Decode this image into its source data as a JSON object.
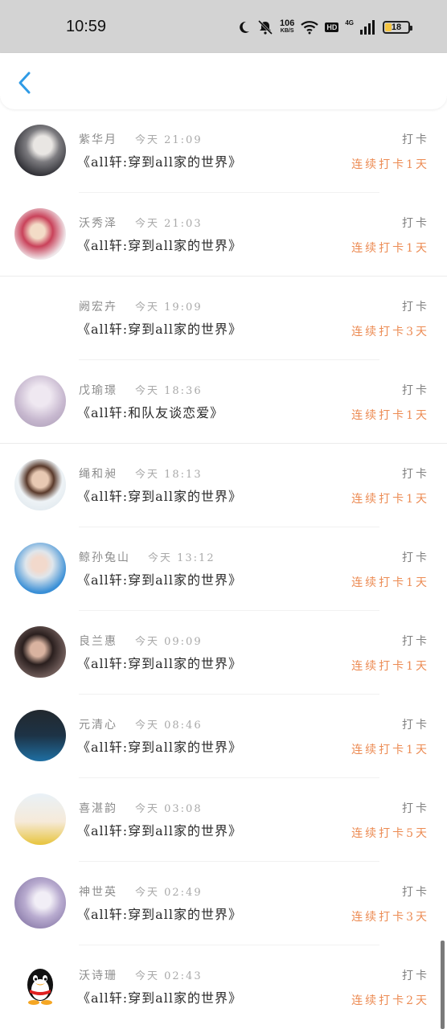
{
  "status_bar": {
    "time": "10:59",
    "net_speed_value": "106",
    "net_speed_unit": "KB/S",
    "hd_label": "HD",
    "network_label": "4G",
    "battery_level": "18"
  },
  "colors": {
    "accent": "#2f9be6",
    "streak": "#ec8b53"
  },
  "entries": [
    {
      "name": "紫华月",
      "time": "今天 21:09",
      "book": "《all轩:穿到all家的世界》",
      "label": "打卡",
      "streak": "连续打卡1天"
    },
    {
      "name": "沃秀泽",
      "time": "今天 21:03",
      "book": "《all轩:穿到all家的世界》",
      "label": "打卡",
      "streak": "连续打卡1天"
    },
    {
      "name": "阙宏卉",
      "time": "今天 19:09",
      "book": "《all轩:穿到all家的世界》",
      "label": "打卡",
      "streak": "连续打卡3天"
    },
    {
      "name": "戊瑜璟",
      "time": "今天 18:36",
      "book": "《all轩:和队友谈恋爱》",
      "label": "打卡",
      "streak": "连续打卡1天"
    },
    {
      "name": "绳和昶",
      "time": "今天 18:13",
      "book": "《all轩:穿到all家的世界》",
      "label": "打卡",
      "streak": "连续打卡1天"
    },
    {
      "name": "鲸孙兔山",
      "time": "今天 13:12",
      "book": "《all轩:穿到all家的世界》",
      "label": "打卡",
      "streak": "连续打卡1天"
    },
    {
      "name": "良兰惠",
      "time": "今天 09:09",
      "book": "《all轩:穿到all家的世界》",
      "label": "打卡",
      "streak": "连续打卡1天"
    },
    {
      "name": "元清心",
      "time": "今天 08:46",
      "book": "《all轩:穿到all家的世界》",
      "label": "打卡",
      "streak": "连续打卡1天"
    },
    {
      "name": "喜湛韵",
      "time": "今天 03:08",
      "book": "《all轩:穿到all家的世界》",
      "label": "打卡",
      "streak": "连续打卡5天"
    },
    {
      "name": "神世英",
      "time": "今天 02:49",
      "book": "《all轩:穿到all家的世界》",
      "label": "打卡",
      "streak": "连续打卡3天"
    },
    {
      "name": "沃诗珊",
      "time": "今天 02:43",
      "book": "《all轩:穿到all家的世界》",
      "label": "打卡",
      "streak": "连续打卡2天"
    }
  ]
}
